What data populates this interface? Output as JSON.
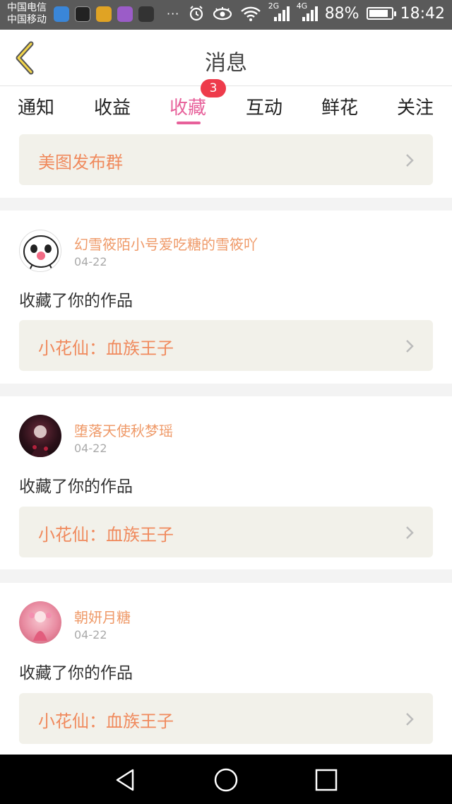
{
  "status_bar": {
    "carrier_1": "中国电信",
    "carrier_2": "中国移动",
    "dots": "···",
    "net_2g": "2G",
    "net_4g": "4G",
    "battery_pct": "88%",
    "battery_level": 0.88,
    "time": "18:42"
  },
  "header": {
    "title": "消息"
  },
  "tabs": [
    {
      "label": "通知"
    },
    {
      "label": "收益"
    },
    {
      "label": "收藏",
      "badge": "3",
      "active": true
    },
    {
      "label": "互动"
    },
    {
      "label": "鲜花"
    },
    {
      "label": "关注"
    }
  ],
  "group_link": {
    "label": "美图发布群"
  },
  "notifications": [
    {
      "username": "幻雪筱陌小号爱吃糖的雪筱吖",
      "date": "04-22",
      "action": "收藏了你的作品",
      "work_title": "小花仙：血族王子"
    },
    {
      "username": "堕落天使秋梦瑶",
      "date": "04-22",
      "action": "收藏了你的作品",
      "work_title": "小花仙：血族王子"
    },
    {
      "username": "朝妍月糖",
      "date": "04-22",
      "action": "收藏了你的作品",
      "work_title": "小花仙：血族王子"
    }
  ],
  "colors": {
    "accent": "#e7609a",
    "badge": "#ee3b4b",
    "username": "#ef9a69",
    "link_text": "#f08a5d",
    "link_bg": "#f2f1ea"
  },
  "icons": [
    "back-arrow-icon",
    "chevron-right-icon",
    "nav-back-icon",
    "nav-home-icon",
    "nav-recents-icon"
  ]
}
